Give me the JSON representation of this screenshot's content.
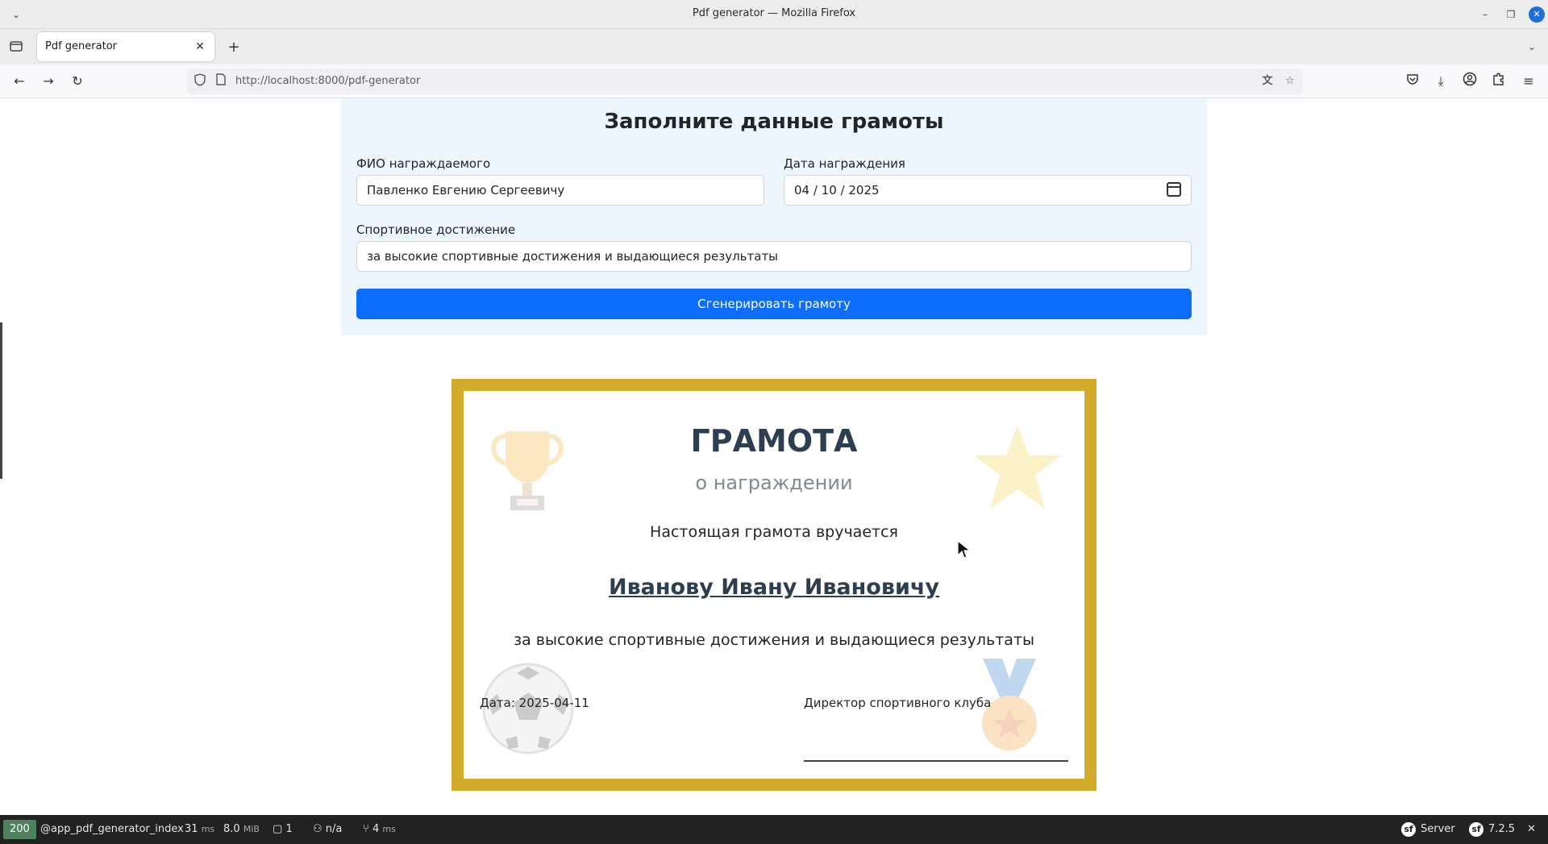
{
  "window": {
    "title": "Pdf generator — Mozilla Firefox",
    "controls": {
      "minimize": "–",
      "restore": "❐",
      "close": "✕"
    }
  },
  "tabs": [
    {
      "label": "Pdf generator",
      "active": true
    }
  ],
  "navigation": {
    "url_host": "http://localhost:8000",
    "url_path": "/pdf-generator"
  },
  "form": {
    "title": "Заполните данные грамоты",
    "fio_label": "ФИО награждаемого",
    "fio_value": "Павленко Евгению Сергеевичу",
    "date_label": "Дата награждения",
    "date_value": "04 / 10 / 2025",
    "achievement_label": "Спортивное достижение",
    "achievement_value": "за высокие спортивные достижения и выдающиеся результаты",
    "submit_label": "Сгенерировать грамоту"
  },
  "certificate": {
    "title": "ГРАМОТА",
    "subtitle": "о награждении",
    "presented_text": "Настоящая грамота вручается",
    "recipient": "Иванову Ивану Ивановичу",
    "achievement": "за высокие спортивные достижения и выдающиеся результаты",
    "date_text": "Дата: 2025-04-11",
    "signatory": "Директор спортивного клуба",
    "colors": {
      "frame": "#d4ac2b",
      "title": "#2c3e50",
      "subtitle": "#7f8c8d"
    },
    "decor_icons": [
      "trophy-icon",
      "star-icon",
      "soccer-ball-icon",
      "medal-icon"
    ]
  },
  "debug_toolbar": {
    "status_code": "200",
    "route": "@app_pdf_generator_index",
    "time_value": "31",
    "time_unit": "ms",
    "memory_value": "8.0",
    "memory_unit": "MiB",
    "forms_count": "1",
    "user": "n/a",
    "twig_value": "4",
    "twig_unit": "ms",
    "server_label": "Server",
    "symfony_version": "7.2.5"
  }
}
